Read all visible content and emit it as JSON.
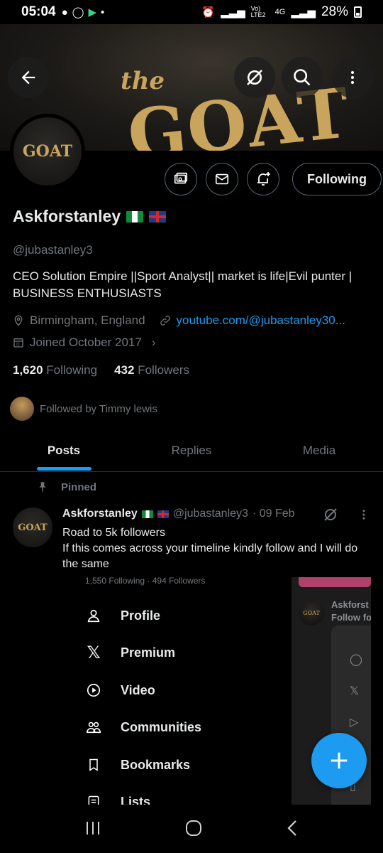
{
  "status_bar": {
    "time": "05:04",
    "battery": "28%",
    "network": "4G",
    "volte": "Vo) LTE2"
  },
  "banner": {
    "art_the": "the",
    "art_goat": "GOAT"
  },
  "avatar": {
    "text": "GOAT"
  },
  "actions": {
    "following_label": "Following"
  },
  "profile": {
    "name": "Askforstanley",
    "handle": "@jubastanley3",
    "bio": "CEO Solution Empire ||Sport Analyst|| market is life|Evil punter | BUSINESS ENTHUSIASTS",
    "location": "Birmingham, England",
    "link": "youtube.com/@jubastanley30...",
    "joined": "Joined October 2017"
  },
  "stats": {
    "following_count": "1,620",
    "following_label": "Following",
    "followers_count": "432",
    "followers_label": "Followers"
  },
  "followed_by": "Followed by Timmy lewis",
  "tabs": [
    "Posts",
    "Replies",
    "Media"
  ],
  "pinned_label": "Pinned",
  "post": {
    "name": "Askforstanley",
    "handle": "@jubastanley3",
    "date": "· 09 Feb",
    "text_line1": "Road to 5k followers",
    "text_line2": "If this comes across your timeline kindly follow and I will do the same",
    "avatar_text": "GOAT"
  },
  "embed": {
    "cutoff_text": "1,550 Following · 494 Followers",
    "menu": [
      {
        "label": "Profile",
        "icon": "person-icon"
      },
      {
        "label": "Premium",
        "icon": "x-logo-icon"
      },
      {
        "label": "Video",
        "icon": "play-icon"
      },
      {
        "label": "Communities",
        "icon": "communities-icon"
      },
      {
        "label": "Bookmarks",
        "icon": "bookmark-icon"
      },
      {
        "label": "Lists",
        "icon": "list-icon"
      }
    ],
    "side_name_line1": "Askforst",
    "side_name_line2": "Follow fo",
    "side_avatar_text": "GOAT"
  },
  "colors": {
    "accent": "#1d9bf0",
    "muted": "#71767b",
    "border": "#536471",
    "gold": "#c9a45c"
  }
}
